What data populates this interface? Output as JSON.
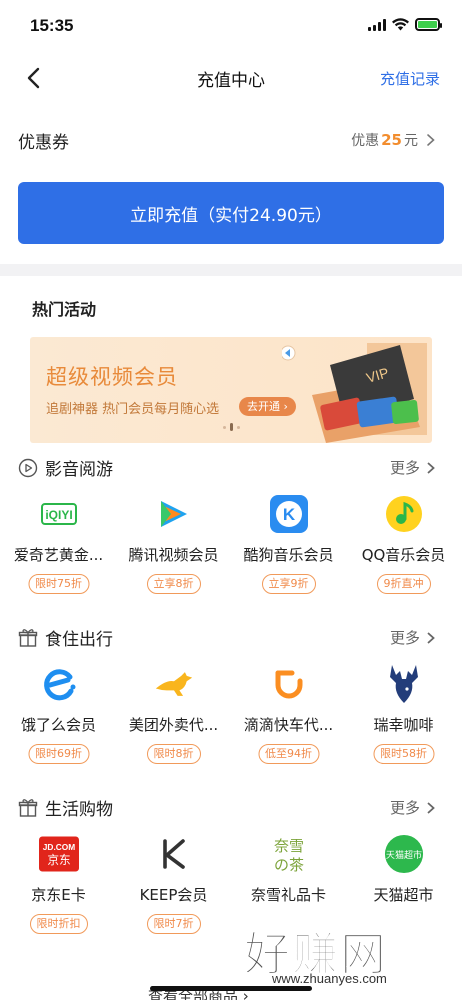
{
  "status_bar": {
    "time": "15:35"
  },
  "nav": {
    "title": "充值中心",
    "right_link": "充值记录"
  },
  "coupon": {
    "label": "优惠券",
    "prefix": "优惠",
    "amount": "25",
    "unit": "元"
  },
  "recharge_button": {
    "label": "立即充值（实付24.90元）"
  },
  "hot": {
    "title": "热门活动"
  },
  "banner": {
    "title": "超级视频会员",
    "subtitle": "追剧神器 热门会员每月随心选",
    "button": "去开通 ›"
  },
  "sections": [
    {
      "title": "影音阅游",
      "more": "更多",
      "items": [
        {
          "name": "爱奇艺黄金...",
          "tag": "限时75折",
          "icon": "iqiyi-logo"
        },
        {
          "name": "腾讯视频会员",
          "tag": "立享8折",
          "icon": "tencent-video-logo"
        },
        {
          "name": "酷狗音乐会员",
          "tag": "立享9折",
          "icon": "kugou-logo"
        },
        {
          "name": "QQ音乐会员",
          "tag": "9折直冲",
          "icon": "qq-music-logo"
        }
      ]
    },
    {
      "title": "食住出行",
      "more": "更多",
      "items": [
        {
          "name": "饿了么会员",
          "tag": "限时69折",
          "icon": "eleme-logo"
        },
        {
          "name": "美团外卖代...",
          "tag": "限时8折",
          "icon": "meituan-kangaroo-logo"
        },
        {
          "name": "滴滴快车代...",
          "tag": "低至94折",
          "icon": "didi-logo"
        },
        {
          "name": "瑞幸咖啡",
          "tag": "限时58折",
          "icon": "luckin-deer-logo"
        }
      ]
    },
    {
      "title": "生活购物",
      "more": "更多",
      "items": [
        {
          "name": "京东E卡",
          "tag": "限时折扣",
          "icon": "jd-logo",
          "logo_text": [
            "JD.COM",
            "京东"
          ]
        },
        {
          "name": "KEEP会员",
          "tag": "限时7折",
          "icon": "keep-logo"
        },
        {
          "name": "奈雪礼品卡",
          "tag": "",
          "icon": "naixue-logo",
          "logo_text": [
            "奈雪",
            "の茶"
          ]
        },
        {
          "name": "天猫超市",
          "tag": "",
          "icon": "tmall-logo",
          "logo_text": [
            "天猫超市"
          ]
        }
      ]
    }
  ],
  "bottom": {
    "peek_text": "查看全部商品 ›"
  },
  "watermark": {
    "text": "好赚网",
    "url": "www.zhuanyes.com"
  },
  "colors": {
    "primary": "#2f6fe6",
    "accent": "#f28d2e",
    "tag": "#f08a4a"
  }
}
